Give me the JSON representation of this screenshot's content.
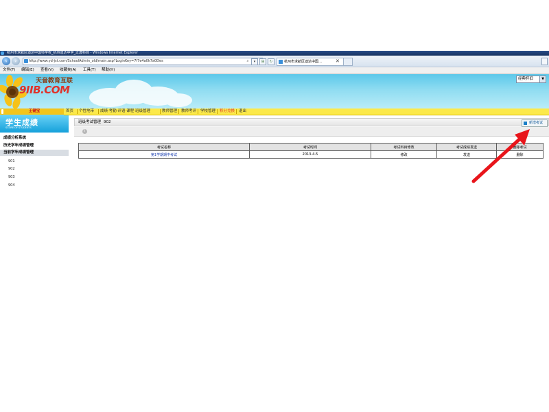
{
  "window": {
    "title": "杭州市求航区迪达中国师学校_杭州迪达中学_过渡科目 - Windows Internet Explorer"
  },
  "address_bar": {
    "url": "http://www.yd-jst.com/SchoolAdmin_old/main.asp?LoginKey=7f7e4a0k7a0Des",
    "search_icon": "magnifier-icon",
    "tab_title": "杭州市求航区迪达中国…"
  },
  "menu": {
    "items": [
      "文件(F)",
      "编辑(E)",
      "查看(V)",
      "收藏夹(A)",
      "工具(T)",
      "帮助(H)"
    ]
  },
  "banner": {
    "logo_text": "天音教育互联",
    "logo_wordmark": "9IIB.COM",
    "style_select": "经典怀旧"
  },
  "user": {
    "name": "王健宝"
  },
  "left_panel": {
    "heading": "学生成绩",
    "heading_en": "SCORE OF STUDENTS",
    "items": [
      {
        "label": "成绩分析系统",
        "selected": false
      },
      {
        "label": "历史学年成绩管理",
        "selected": false
      },
      {
        "label": "当前学年成绩管理",
        "selected": true
      }
    ],
    "classes": [
      "901",
      "902",
      "903",
      "904"
    ]
  },
  "top_nav": {
    "items": [
      {
        "label": "首页",
        "color": "#333333"
      },
      {
        "label": "个性地带",
        "color": "#333333"
      },
      {
        "label": "成绩·考勤·评语·课程·班级管理",
        "color": "#333333"
      },
      {
        "label": "教师管理",
        "color": "#333333"
      },
      {
        "label": "教师考评",
        "color": "#333333"
      },
      {
        "label": "学校管理",
        "color": "#333333"
      },
      {
        "label": "积分兑换",
        "color": "#e0322a"
      },
      {
        "label": "退出",
        "color": "#333333"
      }
    ]
  },
  "section": {
    "title": "班级考试管理",
    "class_code": "902",
    "add_button": "新增考试"
  },
  "exam_table": {
    "headers": [
      "考试名称",
      "考试时间",
      "考试科目修改",
      "考试成绩发送",
      "删除考试"
    ],
    "rows": [
      [
        "第1学期期中考试",
        "2013-4-5",
        "修改",
        "发送",
        "删除"
      ]
    ]
  },
  "colors": {
    "nav_yellow": "#fce94a",
    "panel_blue": "#15a0da",
    "arrow_red": "#e8151b",
    "link_blue": "#1b3fb0"
  }
}
